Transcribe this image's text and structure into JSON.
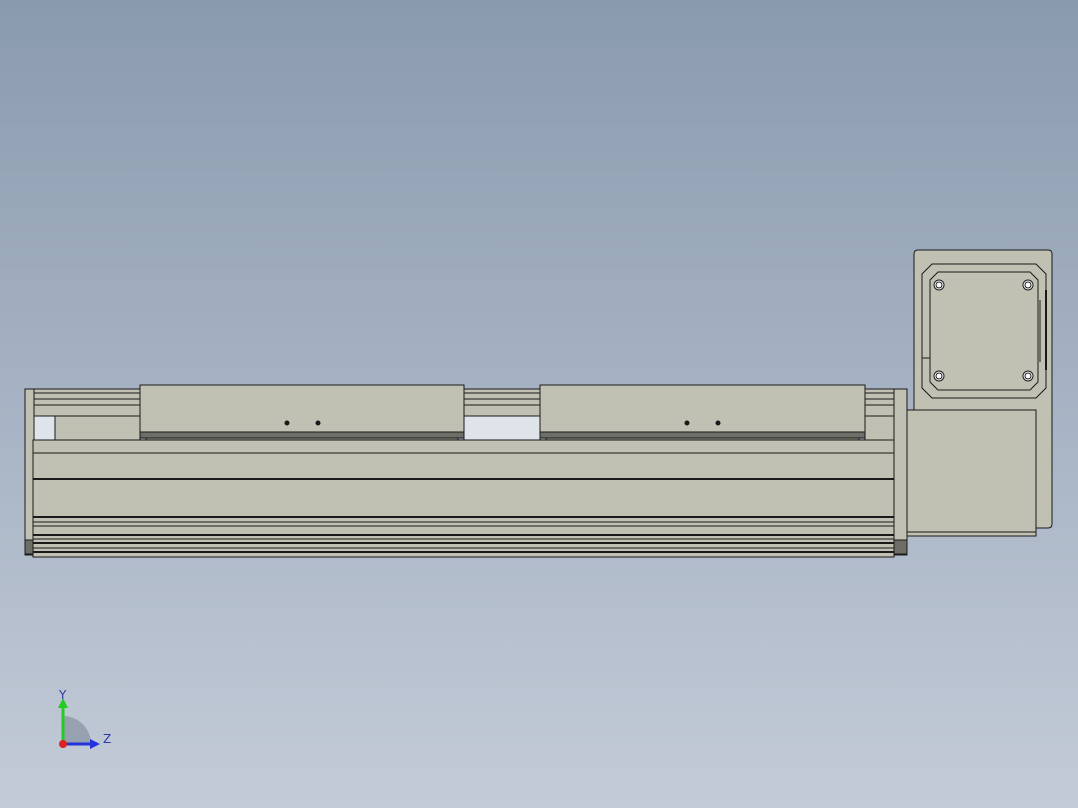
{
  "viewport": {
    "background_top": "#8a9aad",
    "background_bottom": "#c3cbd7"
  },
  "model": {
    "face_color": "#c0c0b3",
    "edge_color": "#1a1a1a",
    "shadow_color": "#6e6e68",
    "carriage_count": 2,
    "motor_hole_count": 4
  },
  "triad": {
    "y_label": "Y",
    "z_label": "Z",
    "y_color": "#22cc22",
    "z_color": "#2233dd",
    "x_color": "#dd2222"
  }
}
